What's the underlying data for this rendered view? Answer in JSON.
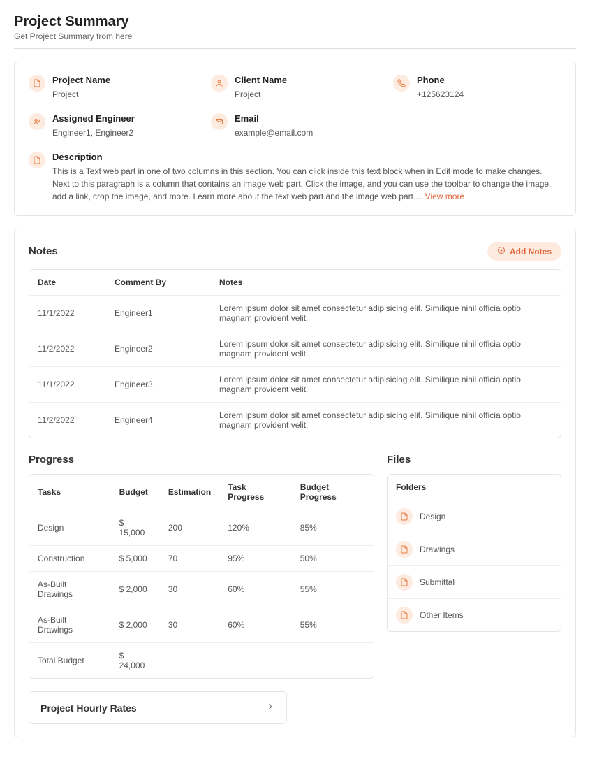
{
  "header": {
    "title": "Project Summary",
    "subtitle": "Get Project Summary from here"
  },
  "summary": {
    "projectName": {
      "label": "Project Name",
      "value": "Project"
    },
    "clientName": {
      "label": "Client Name",
      "value": "Project"
    },
    "phone": {
      "label": "Phone",
      "value": "+125623124"
    },
    "assignedEngineer": {
      "label": "Assigned Engineer",
      "value": "Engineer1, Engineer2"
    },
    "email": {
      "label": "Email",
      "value": "example@email.com"
    },
    "description": {
      "label": "Description",
      "value": "This is a Text web part in one of two columns in this section. You can click inside this text block when in Edit mode to make changes. Next to this paragraph is a column that contains an image web part. Click the image, and you can use the toolbar to change the image, add a link, crop the image, and more. Learn more about the text web part and the image web part....",
      "viewMore": "View more"
    }
  },
  "notes": {
    "title": "Notes",
    "addLabel": "Add Notes",
    "columns": {
      "date": "Date",
      "commentBy": "Comment By",
      "notes": "Notes"
    },
    "rows": [
      {
        "date": "11/1/2022",
        "commentBy": "Engineer1",
        "notes": "Lorem ipsum dolor sit amet consectetur adipisicing elit. Similique nihil officia optio magnam provident velit."
      },
      {
        "date": "11/2/2022",
        "commentBy": "Engineer2",
        "notes": "Lorem ipsum dolor sit amet consectetur adipisicing elit. Similique nihil officia optio magnam provident velit."
      },
      {
        "date": "11/1/2022",
        "commentBy": "Engineer3",
        "notes": "Lorem ipsum dolor sit amet consectetur adipisicing elit. Similique nihil officia optio magnam provident velit."
      },
      {
        "date": "11/2/2022",
        "commentBy": "Engineer4",
        "notes": "Lorem ipsum dolor sit amet consectetur adipisicing elit. Similique nihil officia optio magnam provident velit."
      }
    ]
  },
  "progress": {
    "title": "Progress",
    "columns": {
      "tasks": "Tasks",
      "budget": "Budget",
      "estimation": "Estimation",
      "taskProgress": "Task Progress",
      "budgetProgress": "Budget Progress"
    },
    "rows": [
      {
        "task": "Design",
        "budget": "$ 15,000",
        "estimation": "200",
        "taskPct": "120%",
        "taskCls": "pct-over",
        "budgetPct": "85%",
        "budgetCls": "pct-warn"
      },
      {
        "task": "Construction",
        "budget": "$ 5,000",
        "estimation": "70",
        "taskPct": "95%",
        "taskCls": "pct-warn",
        "budgetPct": "50%",
        "budgetCls": "pct-ok"
      },
      {
        "task": "As-Built Drawings",
        "budget": "$ 2,000",
        "estimation": "30",
        "taskPct": "60%",
        "taskCls": "pct-ok",
        "budgetPct": "55%",
        "budgetCls": "pct-ok"
      },
      {
        "task": "As-Built Drawings",
        "budget": "$ 2,000",
        "estimation": "30",
        "taskPct": "60%",
        "taskCls": "pct-ok",
        "budgetPct": "55%",
        "budgetCls": "pct-ok"
      }
    ],
    "total": {
      "label": "Total Budget",
      "value": "$ 24,000"
    }
  },
  "files": {
    "title": "Files",
    "foldersLabel": "Folders",
    "folders": [
      {
        "name": "Design"
      },
      {
        "name": "Drawings"
      },
      {
        "name": "Submittal"
      },
      {
        "name": "Other Items"
      }
    ]
  },
  "accordion": {
    "title": "Project Hourly Rates"
  }
}
